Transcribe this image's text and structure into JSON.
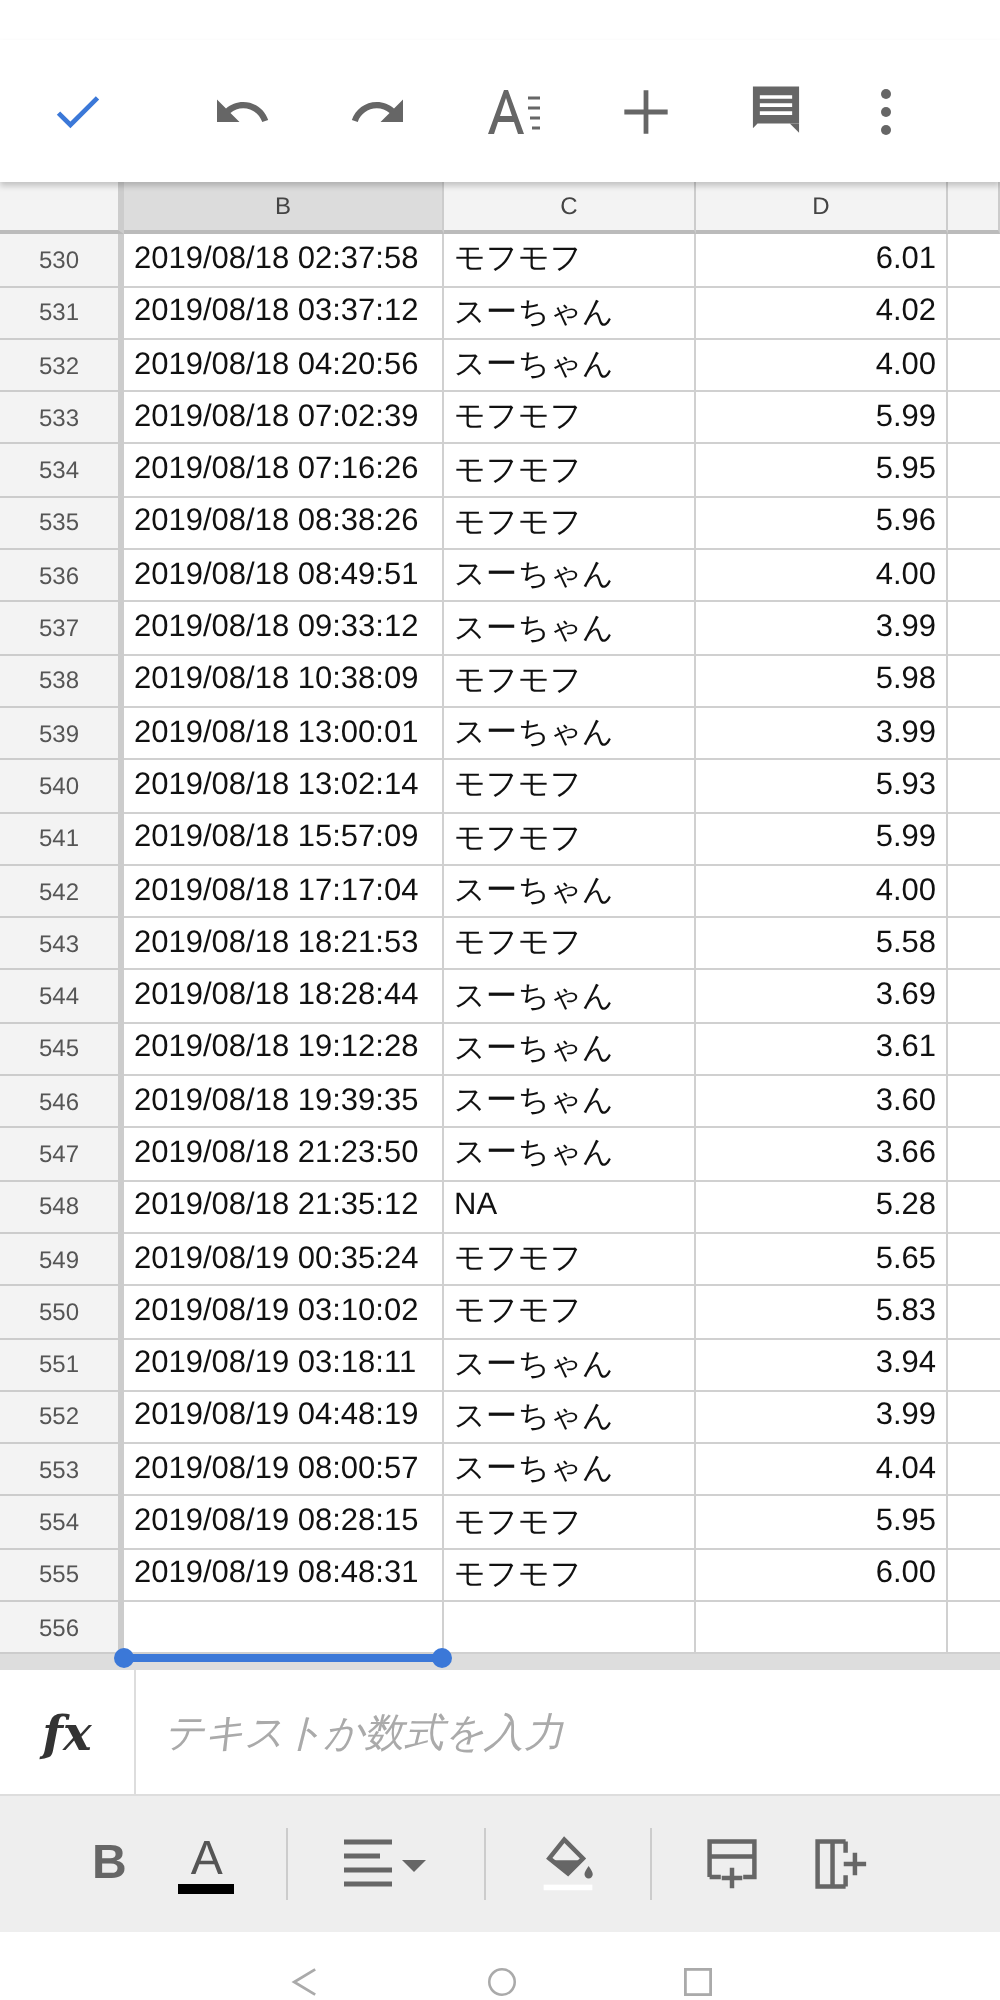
{
  "sheet": {
    "columns": [
      {
        "label": "B",
        "selected": true
      },
      {
        "label": "C",
        "selected": false
      },
      {
        "label": "D",
        "selected": false
      }
    ],
    "rows": [
      {
        "num": "530",
        "b": "2019/08/18 02:37:58",
        "c": "モフモフ",
        "d": "6.01"
      },
      {
        "num": "531",
        "b": "2019/08/18 03:37:12",
        "c": "スーちゃん",
        "d": "4.02"
      },
      {
        "num": "532",
        "b": "2019/08/18 04:20:56",
        "c": "スーちゃん",
        "d": "4.00"
      },
      {
        "num": "533",
        "b": "2019/08/18 07:02:39",
        "c": "モフモフ",
        "d": "5.99"
      },
      {
        "num": "534",
        "b": "2019/08/18 07:16:26",
        "c": "モフモフ",
        "d": "5.95"
      },
      {
        "num": "535",
        "b": "2019/08/18 08:38:26",
        "c": "モフモフ",
        "d": "5.96"
      },
      {
        "num": "536",
        "b": "2019/08/18 08:49:51",
        "c": "スーちゃん",
        "d": "4.00"
      },
      {
        "num": "537",
        "b": "2019/08/18 09:33:12",
        "c": "スーちゃん",
        "d": "3.99"
      },
      {
        "num": "538",
        "b": "2019/08/18 10:38:09",
        "c": "モフモフ",
        "d": "5.98"
      },
      {
        "num": "539",
        "b": "2019/08/18 13:00:01",
        "c": "スーちゃん",
        "d": "3.99"
      },
      {
        "num": "540",
        "b": "2019/08/18 13:02:14",
        "c": "モフモフ",
        "d": "5.93"
      },
      {
        "num": "541",
        "b": "2019/08/18 15:57:09",
        "c": "モフモフ",
        "d": "5.99"
      },
      {
        "num": "542",
        "b": "2019/08/18 17:17:04",
        "c": "スーちゃん",
        "d": "4.00"
      },
      {
        "num": "543",
        "b": "2019/08/18 18:21:53",
        "c": "モフモフ",
        "d": "5.58"
      },
      {
        "num": "544",
        "b": "2019/08/18 18:28:44",
        "c": "スーちゃん",
        "d": "3.69"
      },
      {
        "num": "545",
        "b": "2019/08/18 19:12:28",
        "c": "スーちゃん",
        "d": "3.61"
      },
      {
        "num": "546",
        "b": "2019/08/18 19:39:35",
        "c": "スーちゃん",
        "d": "3.60"
      },
      {
        "num": "547",
        "b": "2019/08/18 21:23:50",
        "c": "スーちゃん",
        "d": "3.66"
      },
      {
        "num": "548",
        "b": "2019/08/18 21:35:12",
        "c": "NA",
        "d": "5.28"
      },
      {
        "num": "549",
        "b": "2019/08/19 00:35:24",
        "c": "モフモフ",
        "d": "5.65"
      },
      {
        "num": "550",
        "b": "2019/08/19 03:10:02",
        "c": "モフモフ",
        "d": "5.83"
      },
      {
        "num": "551",
        "b": "2019/08/19 03:18:11",
        "c": "スーちゃん",
        "d": "3.94"
      },
      {
        "num": "552",
        "b": "2019/08/19 04:48:19",
        "c": "スーちゃん",
        "d": "3.99"
      },
      {
        "num": "553",
        "b": "2019/08/19 08:00:57",
        "c": "スーちゃん",
        "d": "4.04"
      },
      {
        "num": "554",
        "b": "2019/08/19 08:28:15",
        "c": "モフモフ",
        "d": "5.95"
      },
      {
        "num": "555",
        "b": "2019/08/19 08:48:31",
        "c": "モフモフ",
        "d": "6.00"
      },
      {
        "num": "556",
        "b": "",
        "c": "",
        "d": ""
      }
    ]
  },
  "formula_bar": {
    "label": "fx",
    "placeholder": "テキストか数式を入力"
  },
  "format_bar": {
    "bold": "B",
    "text_color": "A"
  }
}
